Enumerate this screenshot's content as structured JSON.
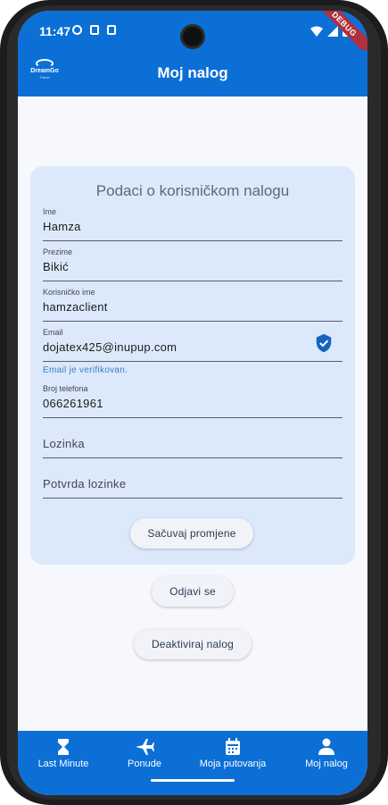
{
  "status_bar": {
    "time": "11:47",
    "debug_label": "DEBUG"
  },
  "app_bar": {
    "title": "Moj nalog",
    "logo_text": "DreamGo",
    "logo_sub": "Travel"
  },
  "card": {
    "title": "Podaci o korisničkom nalogu",
    "fields": {
      "ime": {
        "label": "Ime",
        "value": "Hamza"
      },
      "prezime": {
        "label": "Prezime",
        "value": "Bikić"
      },
      "korisnicko_ime": {
        "label": "Korisničko ime",
        "value": "hamzaclient"
      },
      "email": {
        "label": "Email",
        "value": "dojatex425@inupup.com",
        "helper": "Email je verifikovan."
      },
      "telefon": {
        "label": "Broj telefona",
        "value": "066261961"
      },
      "lozinka": {
        "placeholder": "Lozinka"
      },
      "potvrda_lozinke": {
        "placeholder": "Potvrda lozinke"
      }
    },
    "save_button": "Sačuvaj promjene"
  },
  "actions": {
    "logout_button": "Odjavi se",
    "deactivate_button": "Deaktiviraj nalog"
  },
  "bottom_nav": {
    "items": [
      {
        "label": "Last Minute",
        "icon": "hourglass-icon"
      },
      {
        "label": "Ponude",
        "icon": "airplane-icon"
      },
      {
        "label": "Moja putovanja",
        "icon": "calendar-icon"
      },
      {
        "label": "Moj nalog",
        "icon": "person-icon"
      }
    ]
  },
  "colors": {
    "primary": "#0b6fd6",
    "card_bg": "#dbe9fb",
    "verified": "#1565c0",
    "helper": "#3c7ac8"
  }
}
